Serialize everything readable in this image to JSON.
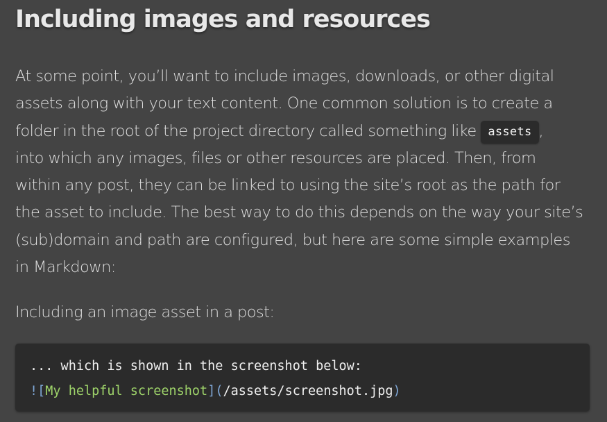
{
  "heading": "Including images and resources",
  "paragraph": {
    "line1": "At some point, you’ll want to include images, downloads, or other digital",
    "line2": "assets along with your text content. One common solution is to create a",
    "line3_before": "folder in the root of the project directory called something like ",
    "line3_code": "assets",
    "line3_after": ",",
    "line4": "into which any images, files or other resources are placed. Then, from",
    "line5": "within any post, they can be linked to using the site’s root as the path for",
    "line6": "the asset to include. The best way to do this depends on the way your site’s",
    "line7": "(sub)domain and path are configured, but here are some simple examples",
    "line8": "in Markdown:"
  },
  "intro2": "Including an image asset in a post:",
  "code": {
    "line1": "... which is shown in the screenshot below:",
    "bang": "!",
    "open_bracket": "[",
    "alt_text": "My helpful screenshot",
    "close_bracket_paren": "](",
    "url": "/assets/screenshot.jpg",
    "close_paren": ")"
  },
  "colors": {
    "background": "#444444",
    "code_background": "#2b2b2b",
    "syntax_punctuation": "#7fa7d6",
    "syntax_string": "#9ed36a"
  }
}
